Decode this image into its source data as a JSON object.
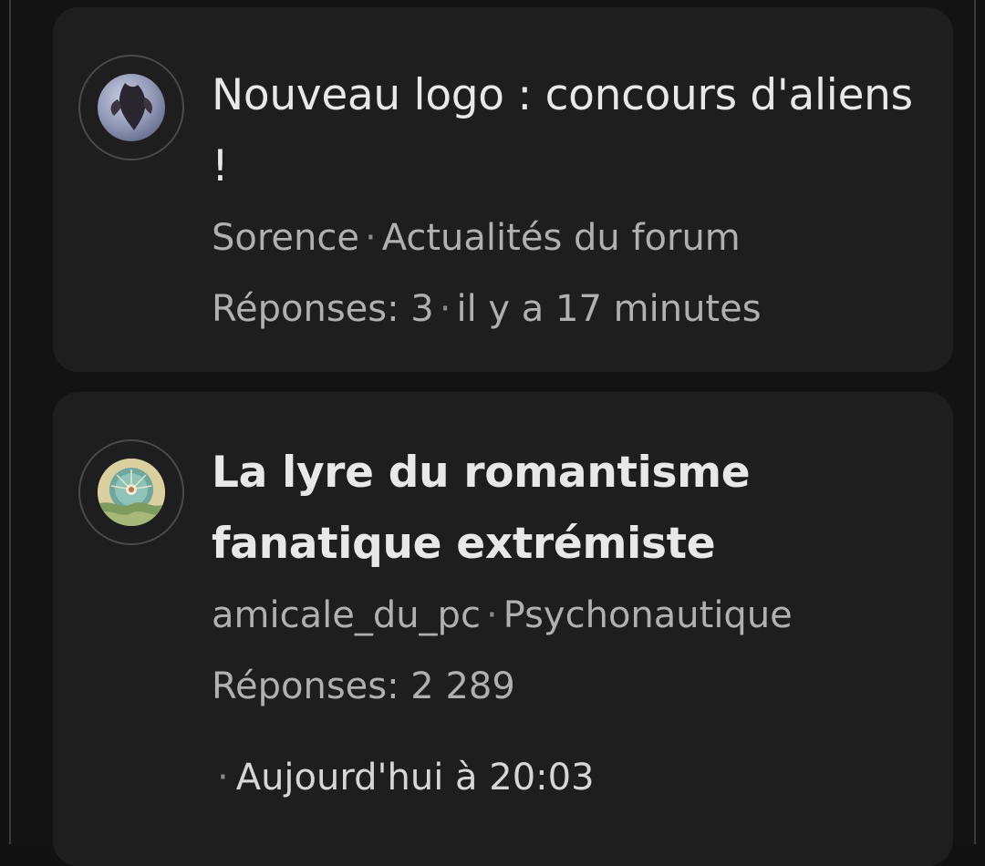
{
  "threads": [
    {
      "title": "Nouveau logo : concours d'aliens !",
      "author": "Sorence",
      "forum": "Actualités du forum",
      "replies_label": "Réponses: 3",
      "time": "il y a 17 minutes",
      "separator": "·",
      "avatar_icon": "bat-photo-avatar"
    },
    {
      "title": "La lyre du romantisme fanatique extrémiste",
      "author": "amicale_du_pc",
      "forum": "Psychonautique",
      "replies_label": "Réponses: 2 289",
      "time": "Aujourd'hui à 20:03",
      "separator": "·",
      "avatar_icon": "art-nouveau-tile-avatar"
    }
  ]
}
